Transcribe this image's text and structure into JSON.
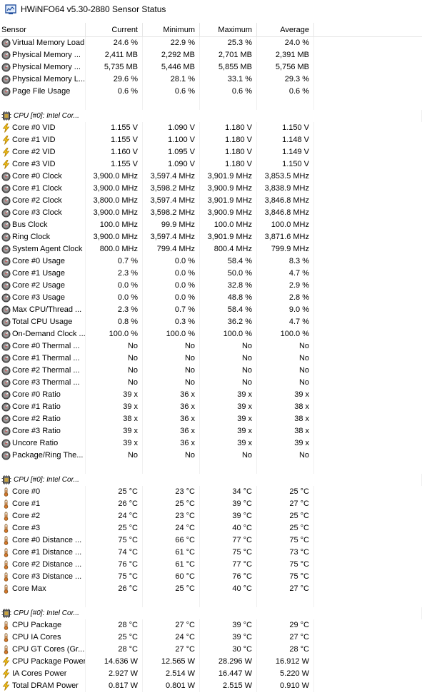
{
  "window": {
    "title": "HWiNFO64 v5.30-2880 Sensor Status"
  },
  "columns": {
    "sensor": "Sensor",
    "current": "Current",
    "minimum": "Minimum",
    "maximum": "Maximum",
    "average": "Average"
  },
  "rows": [
    {
      "type": "sensor",
      "icon": "gauge-icon",
      "name": "Virtual Memory Load",
      "current": "24.6 %",
      "minimum": "22.9 %",
      "maximum": "25.3 %",
      "average": "24.0 %"
    },
    {
      "type": "sensor",
      "icon": "gauge-icon",
      "name": "Physical Memory ...",
      "current": "2,411 MB",
      "minimum": "2,292 MB",
      "maximum": "2,701 MB",
      "average": "2,391 MB"
    },
    {
      "type": "sensor",
      "icon": "gauge-icon",
      "name": "Physical Memory ...",
      "current": "5,735 MB",
      "minimum": "5,446 MB",
      "maximum": "5,855 MB",
      "average": "5,756 MB"
    },
    {
      "type": "sensor",
      "icon": "gauge-icon",
      "name": "Physical Memory L...",
      "current": "29.6 %",
      "minimum": "28.1 %",
      "maximum": "33.1 %",
      "average": "29.3 %"
    },
    {
      "type": "sensor",
      "icon": "gauge-icon",
      "name": "Page File Usage",
      "current": "0.6 %",
      "minimum": "0.6 %",
      "maximum": "0.6 %",
      "average": "0.6 %"
    },
    {
      "type": "spacer"
    },
    {
      "type": "group",
      "icon": "cpu-chip-icon",
      "name": "CPU [#0]: Intel Cor..."
    },
    {
      "type": "sensor",
      "icon": "voltage-icon",
      "name": "Core #0 VID",
      "current": "1.155 V",
      "minimum": "1.090 V",
      "maximum": "1.180 V",
      "average": "1.150 V"
    },
    {
      "type": "sensor",
      "icon": "voltage-icon",
      "name": "Core #1 VID",
      "current": "1.155 V",
      "minimum": "1.100 V",
      "maximum": "1.180 V",
      "average": "1.148 V"
    },
    {
      "type": "sensor",
      "icon": "voltage-icon",
      "name": "Core #2 VID",
      "current": "1.160 V",
      "minimum": "1.095 V",
      "maximum": "1.180 V",
      "average": "1.149 V"
    },
    {
      "type": "sensor",
      "icon": "voltage-icon",
      "name": "Core #3 VID",
      "current": "1.155 V",
      "minimum": "1.090 V",
      "maximum": "1.180 V",
      "average": "1.150 V"
    },
    {
      "type": "sensor",
      "icon": "gauge-icon",
      "name": "Core #0 Clock",
      "current": "3,900.0 MHz",
      "minimum": "3,597.4 MHz",
      "maximum": "3,901.9 MHz",
      "average": "3,853.5 MHz"
    },
    {
      "type": "sensor",
      "icon": "gauge-icon",
      "name": "Core #1 Clock",
      "current": "3,900.0 MHz",
      "minimum": "3,598.2 MHz",
      "maximum": "3,900.9 MHz",
      "average": "3,838.9 MHz"
    },
    {
      "type": "sensor",
      "icon": "gauge-icon",
      "name": "Core #2 Clock",
      "current": "3,800.0 MHz",
      "minimum": "3,597.4 MHz",
      "maximum": "3,901.9 MHz",
      "average": "3,846.8 MHz"
    },
    {
      "type": "sensor",
      "icon": "gauge-icon",
      "name": "Core #3 Clock",
      "current": "3,900.0 MHz",
      "minimum": "3,598.2 MHz",
      "maximum": "3,900.9 MHz",
      "average": "3,846.8 MHz"
    },
    {
      "type": "sensor",
      "icon": "gauge-icon",
      "name": "Bus Clock",
      "current": "100.0 MHz",
      "minimum": "99.9 MHz",
      "maximum": "100.0 MHz",
      "average": "100.0 MHz"
    },
    {
      "type": "sensor",
      "icon": "gauge-icon",
      "name": "Ring Clock",
      "current": "3,900.0 MHz",
      "minimum": "3,597.4 MHz",
      "maximum": "3,901.9 MHz",
      "average": "3,871.6 MHz"
    },
    {
      "type": "sensor",
      "icon": "gauge-icon",
      "name": "System Agent Clock",
      "current": "800.0 MHz",
      "minimum": "799.4 MHz",
      "maximum": "800.4 MHz",
      "average": "799.9 MHz"
    },
    {
      "type": "sensor",
      "icon": "gauge-icon",
      "name": "Core #0 Usage",
      "current": "0.7 %",
      "minimum": "0.0 %",
      "maximum": "58.4 %",
      "average": "8.3 %"
    },
    {
      "type": "sensor",
      "icon": "gauge-icon",
      "name": "Core #1 Usage",
      "current": "2.3 %",
      "minimum": "0.0 %",
      "maximum": "50.0 %",
      "average": "4.7 %"
    },
    {
      "type": "sensor",
      "icon": "gauge-icon",
      "name": "Core #2 Usage",
      "current": "0.0 %",
      "minimum": "0.0 %",
      "maximum": "32.8 %",
      "average": "2.9 %"
    },
    {
      "type": "sensor",
      "icon": "gauge-icon",
      "name": "Core #3 Usage",
      "current": "0.0 %",
      "minimum": "0.0 %",
      "maximum": "48.8 %",
      "average": "2.8 %"
    },
    {
      "type": "sensor",
      "icon": "gauge-icon",
      "name": "Max CPU/Thread ...",
      "current": "2.3 %",
      "minimum": "0.7 %",
      "maximum": "58.4 %",
      "average": "9.0 %"
    },
    {
      "type": "sensor",
      "icon": "gauge-icon",
      "name": "Total CPU Usage",
      "current": "0.8 %",
      "minimum": "0.3 %",
      "maximum": "36.2 %",
      "average": "4.7 %"
    },
    {
      "type": "sensor",
      "icon": "gauge-icon",
      "name": "On-Demand Clock ...",
      "current": "100.0 %",
      "minimum": "100.0 %",
      "maximum": "100.0 %",
      "average": "100.0 %"
    },
    {
      "type": "sensor",
      "icon": "gauge-icon",
      "name": "Core #0 Thermal ...",
      "current": "No",
      "minimum": "No",
      "maximum": "No",
      "average": "No"
    },
    {
      "type": "sensor",
      "icon": "gauge-icon",
      "name": "Core #1 Thermal ...",
      "current": "No",
      "minimum": "No",
      "maximum": "No",
      "average": "No"
    },
    {
      "type": "sensor",
      "icon": "gauge-icon",
      "name": "Core #2 Thermal ...",
      "current": "No",
      "minimum": "No",
      "maximum": "No",
      "average": "No"
    },
    {
      "type": "sensor",
      "icon": "gauge-icon",
      "name": "Core #3 Thermal ...",
      "current": "No",
      "minimum": "No",
      "maximum": "No",
      "average": "No"
    },
    {
      "type": "sensor",
      "icon": "gauge-icon",
      "name": "Core #0 Ratio",
      "current": "39 x",
      "minimum": "36 x",
      "maximum": "39 x",
      "average": "39 x"
    },
    {
      "type": "sensor",
      "icon": "gauge-icon",
      "name": "Core #1 Ratio",
      "current": "39 x",
      "minimum": "36 x",
      "maximum": "39 x",
      "average": "38 x"
    },
    {
      "type": "sensor",
      "icon": "gauge-icon",
      "name": "Core #2 Ratio",
      "current": "38 x",
      "minimum": "36 x",
      "maximum": "39 x",
      "average": "38 x"
    },
    {
      "type": "sensor",
      "icon": "gauge-icon",
      "name": "Core #3 Ratio",
      "current": "39 x",
      "minimum": "36 x",
      "maximum": "39 x",
      "average": "38 x"
    },
    {
      "type": "sensor",
      "icon": "gauge-icon",
      "name": "Uncore Ratio",
      "current": "39 x",
      "minimum": "36 x",
      "maximum": "39 x",
      "average": "39 x"
    },
    {
      "type": "sensor",
      "icon": "gauge-icon",
      "name": "Package/Ring The...",
      "current": "No",
      "minimum": "No",
      "maximum": "No",
      "average": "No"
    },
    {
      "type": "spacer"
    },
    {
      "type": "group",
      "icon": "cpu-chip-icon",
      "name": "CPU [#0]: Intel Cor..."
    },
    {
      "type": "sensor",
      "icon": "thermometer-icon",
      "name": "Core #0",
      "current": "25 °C",
      "minimum": "23 °C",
      "maximum": "34 °C",
      "average": "25 °C"
    },
    {
      "type": "sensor",
      "icon": "thermometer-icon",
      "name": "Core #1",
      "current": "26 °C",
      "minimum": "25 °C",
      "maximum": "39 °C",
      "average": "27 °C"
    },
    {
      "type": "sensor",
      "icon": "thermometer-icon",
      "name": "Core #2",
      "current": "24 °C",
      "minimum": "23 °C",
      "maximum": "39 °C",
      "average": "25 °C"
    },
    {
      "type": "sensor",
      "icon": "thermometer-icon",
      "name": "Core #3",
      "current": "25 °C",
      "minimum": "24 °C",
      "maximum": "40 °C",
      "average": "25 °C"
    },
    {
      "type": "sensor",
      "icon": "thermometer-icon",
      "name": "Core #0 Distance ...",
      "current": "75 °C",
      "minimum": "66 °C",
      "maximum": "77 °C",
      "average": "75 °C"
    },
    {
      "type": "sensor",
      "icon": "thermometer-icon",
      "name": "Core #1 Distance ...",
      "current": "74 °C",
      "minimum": "61 °C",
      "maximum": "75 °C",
      "average": "73 °C"
    },
    {
      "type": "sensor",
      "icon": "thermometer-icon",
      "name": "Core #2 Distance ...",
      "current": "76 °C",
      "minimum": "61 °C",
      "maximum": "77 °C",
      "average": "75 °C"
    },
    {
      "type": "sensor",
      "icon": "thermometer-icon",
      "name": "Core #3 Distance ...",
      "current": "75 °C",
      "minimum": "60 °C",
      "maximum": "76 °C",
      "average": "75 °C"
    },
    {
      "type": "sensor",
      "icon": "thermometer-icon",
      "name": "Core Max",
      "current": "26 °C",
      "minimum": "25 °C",
      "maximum": "40 °C",
      "average": "27 °C"
    },
    {
      "type": "spacer"
    },
    {
      "type": "group",
      "icon": "cpu-chip-icon",
      "name": "CPU [#0]: Intel Cor..."
    },
    {
      "type": "sensor",
      "icon": "thermometer-icon",
      "name": "CPU Package",
      "current": "28 °C",
      "minimum": "27 °C",
      "maximum": "39 °C",
      "average": "29 °C"
    },
    {
      "type": "sensor",
      "icon": "thermometer-icon",
      "name": "CPU IA Cores",
      "current": "25 °C",
      "minimum": "24 °C",
      "maximum": "39 °C",
      "average": "27 °C"
    },
    {
      "type": "sensor",
      "icon": "thermometer-icon",
      "name": "CPU GT Cores (Gr...",
      "current": "28 °C",
      "minimum": "27 °C",
      "maximum": "30 °C",
      "average": "28 °C"
    },
    {
      "type": "sensor",
      "icon": "power-icon",
      "name": "CPU Package Power",
      "current": "14.636 W",
      "minimum": "12.565 W",
      "maximum": "28.296 W",
      "average": "16.912 W"
    },
    {
      "type": "sensor",
      "icon": "power-icon",
      "name": "IA Cores Power",
      "current": "2.927 W",
      "minimum": "2.514 W",
      "maximum": "16.447 W",
      "average": "5.220 W"
    },
    {
      "type": "sensor",
      "icon": "power-icon",
      "name": "Total DRAM Power",
      "current": "0.817 W",
      "minimum": "0.801 W",
      "maximum": "2.515 W",
      "average": "0.910 W"
    }
  ]
}
